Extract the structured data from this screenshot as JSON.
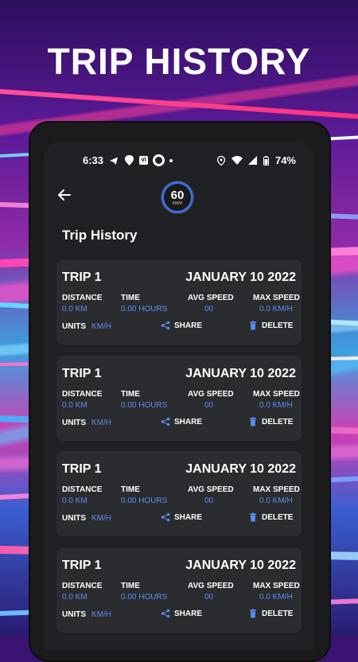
{
  "headline": "TRIP HISTORY",
  "status_bar": {
    "time": "6:33",
    "battery": "74%"
  },
  "speedometer": {
    "value": "60",
    "unit": "KM/H"
  },
  "page_title": "Trip History",
  "columns": {
    "distance": "DISTANCE",
    "time": "TIME",
    "avg_speed": "AVG SPEED",
    "max_speed": "MAX SPEED",
    "units": "UNITS"
  },
  "actions": {
    "share": "SHARE",
    "delete": "DELETE"
  },
  "trips": [
    {
      "name": "TRIP 1",
      "date": "JANUARY 10 2022",
      "distance": "0.0 KM",
      "time": "0.00 HOURS",
      "avg_speed": "00",
      "max_speed": "0.0 KM/H",
      "units": "KM/H"
    },
    {
      "name": "TRIP 1",
      "date": "JANUARY 10 2022",
      "distance": "0.0 KM",
      "time": "0.00 HOURS",
      "avg_speed": "00",
      "max_speed": "0.0 KM/H",
      "units": "KM/H"
    },
    {
      "name": "TRIP 1",
      "date": "JANUARY 10 2022",
      "distance": "0.0 KM",
      "time": "0.00 HOURS",
      "avg_speed": "00",
      "max_speed": "0.0 KM/H",
      "units": "KM/H"
    },
    {
      "name": "TRIP 1",
      "date": "JANUARY 10 2022",
      "distance": "0.0 KM",
      "time": "0.00 HOURS",
      "avg_speed": "00",
      "max_speed": "0.0 KM/H",
      "units": "KM/H"
    }
  ],
  "colors": {
    "accent": "#5b8df2",
    "card": "#2b2c2f",
    "screen": "#202124"
  }
}
